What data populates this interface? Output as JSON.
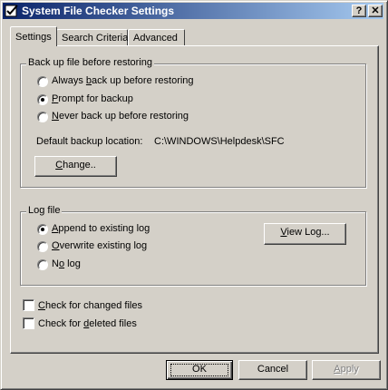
{
  "window": {
    "title": "System File Checker Settings",
    "icon": "checkmark-app-icon"
  },
  "titlebar": {
    "help_glyph": "?",
    "close_glyph": "✕"
  },
  "tabs": [
    {
      "label": "Settings",
      "active": true
    },
    {
      "label": "Search Criteria",
      "active": false
    },
    {
      "label": "Advanced",
      "active": false
    }
  ],
  "backup_group": {
    "legend": "Back up file before restoring",
    "options": [
      {
        "pre": "Always ",
        "key": "b",
        "post": "ack up before restoring",
        "selected": false
      },
      {
        "pre": "",
        "key": "P",
        "post": "rompt for backup",
        "selected": true
      },
      {
        "pre": "",
        "key": "N",
        "post": "ever back up before restoring",
        "selected": false
      }
    ],
    "location_label": "Default backup location:",
    "location_value": "C:\\WINDOWS\\Helpdesk\\SFC",
    "change_button": {
      "key": "C",
      "rest": "hange.."
    }
  },
  "log_group": {
    "legend": "Log file",
    "options": [
      {
        "pre": "",
        "key": "A",
        "post": "ppend to existing log",
        "selected": true
      },
      {
        "pre": "",
        "key": "O",
        "post": "verwrite existing log",
        "selected": false
      },
      {
        "pre": "N",
        "key": "o",
        "post": " log",
        "selected": false
      }
    ],
    "view_log_button": {
      "key": "V",
      "rest": "iew Log..."
    }
  },
  "checks": [
    {
      "pre": "",
      "key": "C",
      "post": "heck for changed files",
      "checked": false
    },
    {
      "pre": "Check for ",
      "key": "d",
      "post": "eleted files",
      "checked": false
    }
  ],
  "buttons": {
    "ok": "OK",
    "cancel": "Cancel",
    "apply": {
      "key": "A",
      "rest": "pply",
      "disabled": true
    }
  }
}
